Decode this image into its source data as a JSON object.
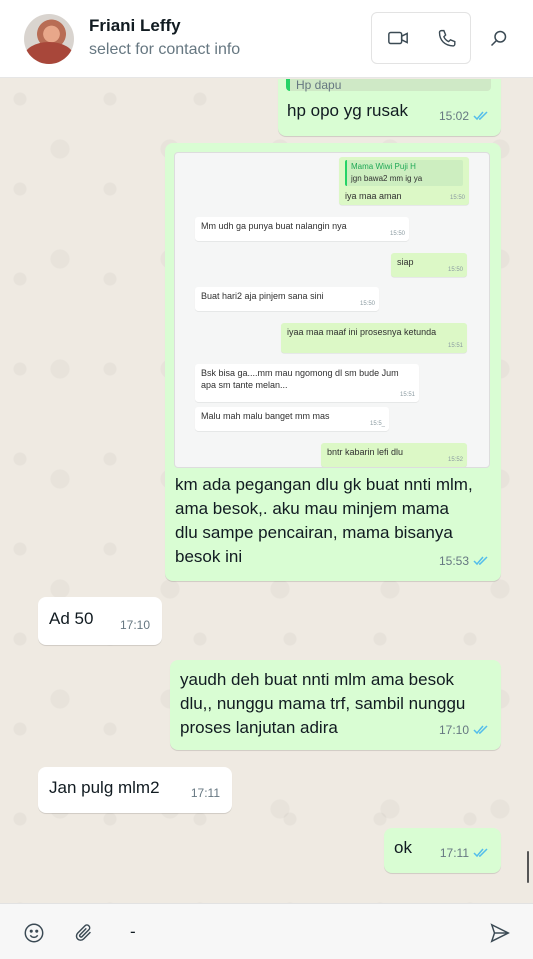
{
  "header": {
    "contact_name": "Friani Leffy",
    "contact_sub": "select for contact info"
  },
  "messages": [
    {
      "dir": "out",
      "quote_fragment": "Hp dapu",
      "text": "hp opo yg rusak",
      "time": "15:02"
    },
    {
      "dir": "out",
      "image": {
        "reply_sender": "Mama Wiwi Puji H",
        "reply_text": "jgn bawa2 mm ig ya",
        "rows": [
          {
            "dir": "out",
            "text": "iya maa aman",
            "time": "15:50"
          },
          {
            "dir": "in",
            "text": "Mm udh ga punya buat nalangin nya",
            "time": "15:50"
          },
          {
            "dir": "out",
            "text": "siap",
            "time": "15:50"
          },
          {
            "dir": "in",
            "text": "Buat hari2 aja pinjem sana sini",
            "time": "15:50"
          },
          {
            "dir": "out",
            "text": "iyaa maa maaf ini prosesnya ketunda",
            "time": "15:51"
          },
          {
            "dir": "in",
            "text": "Bsk bisa ga....mm mau ngomong dl sm bude Jum apa sm tante melan...",
            "time": "15:51"
          },
          {
            "dir": "in",
            "text": "Malu mah malu banget mm mas",
            "time": "15:5_"
          },
          {
            "dir": "out",
            "text": "bntr kabarin lefi dlu",
            "time": "15:52"
          }
        ]
      },
      "text": "km ada pegangan dlu gk buat nnti mlm, ama besok,. aku mau minjem mama dlu sampe pencairan, mama bisanya besok ini",
      "time": "15:53"
    },
    {
      "dir": "in",
      "text": "Ad 50",
      "time": "17:10"
    },
    {
      "dir": "out",
      "text": "yaudh deh buat nnti mlm ama besok dlu,, nunggu mama trf, sambil nunggu proses lanjutan adira",
      "time": "17:10"
    },
    {
      "dir": "in",
      "text": "Jan pulg mlm2",
      "time": "17:11"
    },
    {
      "dir": "out",
      "text": "ok",
      "time": "17:11"
    }
  ],
  "composer": {
    "value": "-",
    "placeholder": ""
  },
  "colors": {
    "outgoing_bubble": "#d9fdd3",
    "incoming_bubble": "#ffffff",
    "read_tick": "#53bdeb",
    "background": "#efeae2"
  },
  "icons": {
    "video": "video-camera-icon",
    "phone": "phone-icon",
    "search": "search-icon",
    "emoji": "emoji-icon",
    "attach": "paperclip-icon",
    "send": "send-icon"
  }
}
